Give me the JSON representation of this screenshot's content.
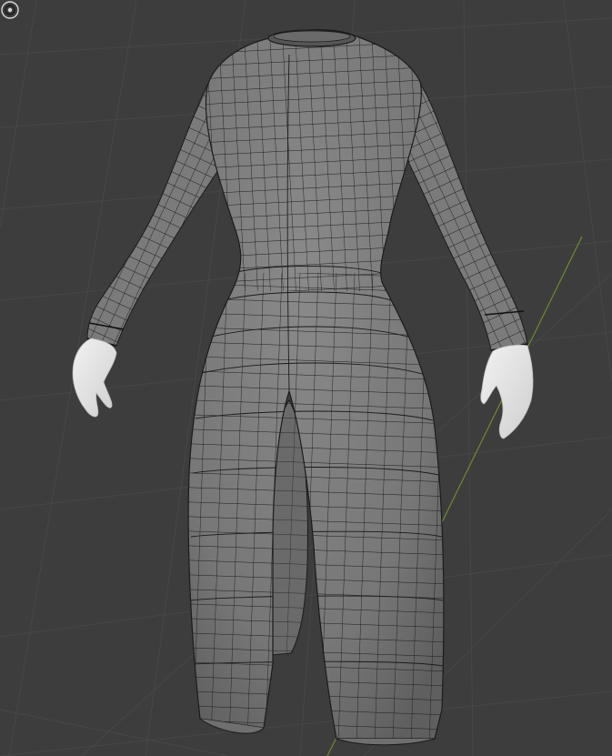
{
  "viewport": {
    "background_color": "#3d3d3d",
    "grid_color": "#474747",
    "y_axis_color": "#6d8a2e"
  },
  "model": {
    "description_icon": "mesh-wireframe",
    "garment_fill": "#808080",
    "garment_shade": "#6e6e6e",
    "wire_color": "#1b1b1b",
    "skin_fill": "#e6e6e6"
  },
  "overlay": {
    "origin_icon": "object-origin-icon"
  }
}
